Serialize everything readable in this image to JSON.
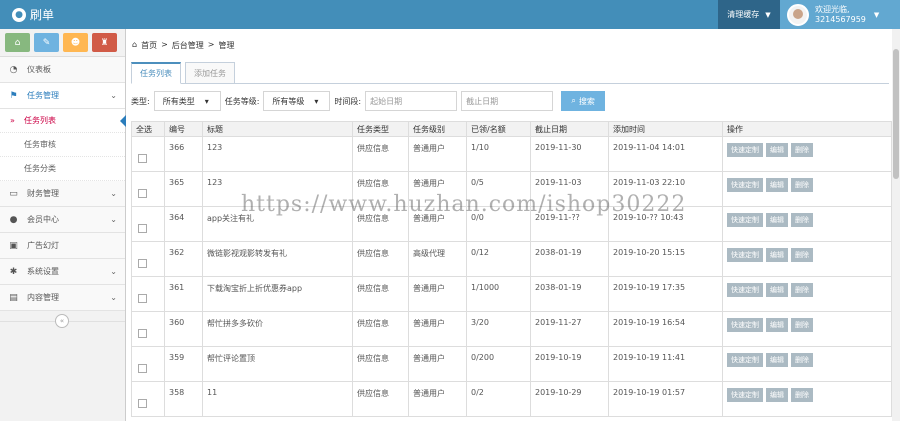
{
  "app": {
    "title": "刷单"
  },
  "topbar": {
    "clear_cache": "清理缓存",
    "user_greeting": "欢迎光临,",
    "user_phone": "3214567959"
  },
  "sidebar": {
    "items": [
      {
        "label": "仪表板",
        "icon": "dashboard-icon"
      },
      {
        "label": "任务管理",
        "icon": "flag-icon"
      },
      {
        "label": "财务管理",
        "icon": "money-icon"
      },
      {
        "label": "会员中心",
        "icon": "user-icon"
      },
      {
        "label": "广告幻灯",
        "icon": "picture-icon"
      },
      {
        "label": "系统设置",
        "icon": "gear-icon"
      },
      {
        "label": "内容管理",
        "icon": "book-icon"
      }
    ],
    "sub_items": [
      "任务列表",
      "任务审核",
      "任务分类"
    ]
  },
  "breadcrumb": {
    "home": "首页",
    "sep": ">",
    "level2": "后台管理",
    "level3": "管理"
  },
  "tabs": [
    "任务列表",
    "添加任务"
  ],
  "filters": {
    "type_label": "类型:",
    "type_value": "所有类型",
    "level_label": "任务等级:",
    "level_value": "所有等级",
    "time_label": "时间段:",
    "start_placeholder": "起始日期",
    "end_placeholder": "截止日期",
    "search_label": "搜索"
  },
  "table": {
    "headers": [
      "全选",
      "编号",
      "标题",
      "任务类型",
      "任务级别",
      "已领/名额",
      "截止日期",
      "添加时间",
      "操作"
    ],
    "actions": [
      "快速定制",
      "编辑",
      "删除"
    ],
    "rows": [
      {
        "id": "366",
        "title": "123",
        "type": "供应信息",
        "level": "普通用户",
        "quota": "1/10",
        "deadline": "2019-11-30",
        "added": "2019-11-04 14:01"
      },
      {
        "id": "365",
        "title": "123",
        "type": "供应信息",
        "level": "普通用户",
        "quota": "0/5",
        "deadline": "2019-11-03",
        "added": "2019-11-03 22:10"
      },
      {
        "id": "364",
        "title": "app关注有礼",
        "type": "供应信息",
        "level": "普通用户",
        "quota": "0/0",
        "deadline": "2019-11-??",
        "added": "2019-10-?? 10:43"
      },
      {
        "id": "362",
        "title": "微链影视观影转发有礼",
        "type": "供应信息",
        "level": "高级代理",
        "quota": "0/12",
        "deadline": "2038-01-19",
        "added": "2019-10-20 15:15"
      },
      {
        "id": "361",
        "title": "下载淘宝折上折优惠券app",
        "type": "供应信息",
        "level": "普通用户",
        "quota": "1/1000",
        "deadline": "2038-01-19",
        "added": "2019-10-19 17:35"
      },
      {
        "id": "360",
        "title": "帮忙拼多多砍价",
        "type": "供应信息",
        "level": "普通用户",
        "quota": "3/20",
        "deadline": "2019-11-27",
        "added": "2019-10-19 16:54"
      },
      {
        "id": "359",
        "title": "帮忙评论置顶",
        "type": "供应信息",
        "level": "普通用户",
        "quota": "0/200",
        "deadline": "2019-10-19",
        "added": "2019-10-19 11:41"
      },
      {
        "id": "358",
        "title": "11",
        "type": "供应信息",
        "level": "普通用户",
        "quota": "0/2",
        "deadline": "2019-10-29",
        "added": "2019-10-19 01:57"
      }
    ]
  },
  "watermark": "https://www.huzhan.com/ishop30222",
  "colors": {
    "topbar": "#438eb9",
    "accent": "#2b7dbc",
    "active_sub": "#cc0044"
  }
}
